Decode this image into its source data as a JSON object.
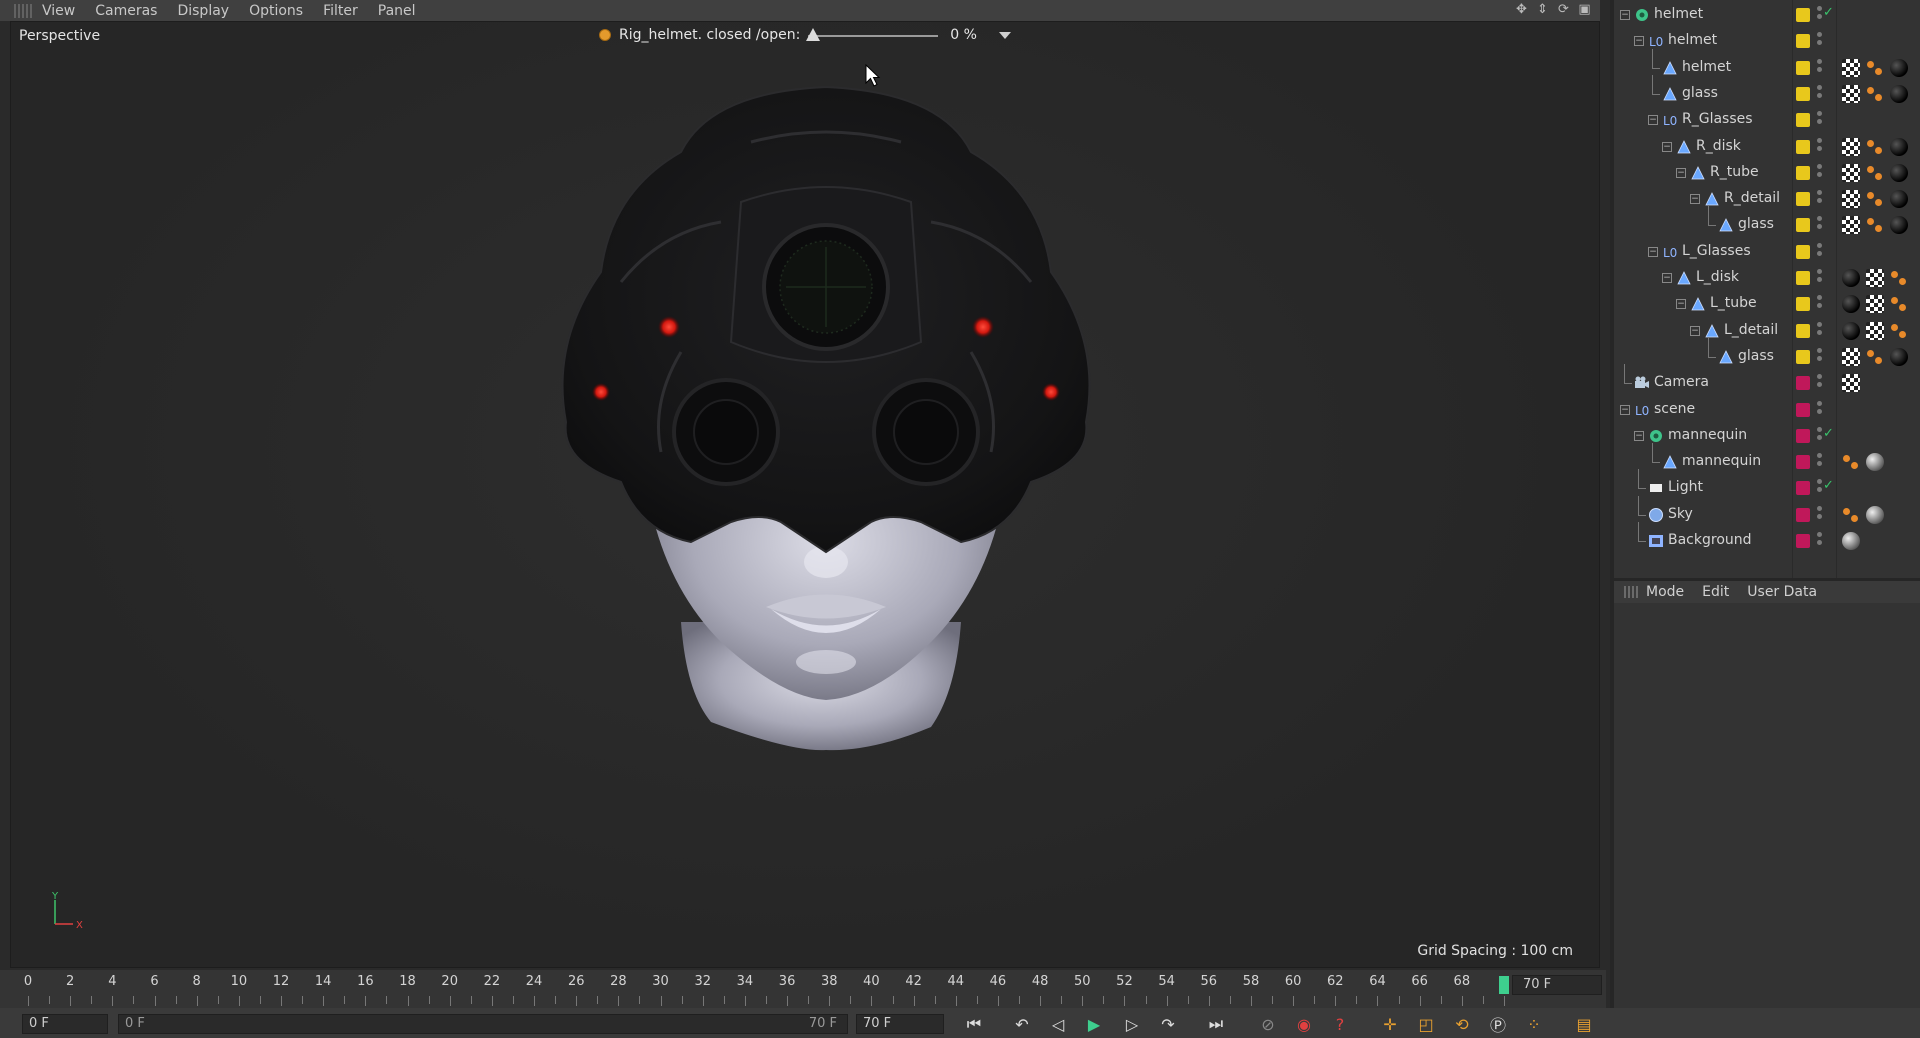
{
  "viewport_menu": {
    "items": [
      "View",
      "Cameras",
      "Display",
      "Options",
      "Filter",
      "Panel"
    ]
  },
  "viewport": {
    "label": "Perspective",
    "rig": {
      "label": "Rig_helmet. closed /open:",
      "value": "0 %",
      "fraction": 0.0
    },
    "grid_spacing": "Grid Spacing : 100 cm",
    "axis_y": "Y",
    "axis_x": "X"
  },
  "object_manager": {
    "rows": [
      {
        "name": "helmet",
        "icon": "null-green-icon",
        "color": "#e8c81c",
        "check": true
      },
      {
        "name": "helmet",
        "icon": "group-icon",
        "color": "#e8c81c"
      },
      {
        "name": "helmet",
        "icon": "polygon-icon",
        "color": "#e8c81c",
        "tags": [
          "checker",
          "rig",
          "dark"
        ]
      },
      {
        "name": "glass",
        "icon": "polygon-icon",
        "color": "#e8c81c",
        "tags": [
          "checker",
          "rig",
          "dark"
        ]
      },
      {
        "name": "R_Glasses",
        "icon": "group-icon",
        "color": "#e8c81c"
      },
      {
        "name": "R_disk",
        "icon": "polygon-icon",
        "color": "#e8c81c",
        "tags": [
          "checker",
          "rig",
          "dark"
        ]
      },
      {
        "name": "R_tube",
        "icon": "polygon-icon",
        "color": "#e8c81c",
        "tags": [
          "checker",
          "rig",
          "dark"
        ]
      },
      {
        "name": "R_detail",
        "icon": "polygon-icon",
        "color": "#e8c81c",
        "tags": [
          "checker",
          "rig",
          "dark"
        ]
      },
      {
        "name": "glass",
        "icon": "polygon-icon",
        "color": "#e8c81c",
        "tags": [
          "checker",
          "rig",
          "dark"
        ]
      },
      {
        "name": "L_Glasses",
        "icon": "group-icon",
        "color": "#e8c81c"
      },
      {
        "name": "L_disk",
        "icon": "polygon-icon",
        "color": "#e8c81c",
        "tags": [
          "dark",
          "checker",
          "rig"
        ]
      },
      {
        "name": "L_tube",
        "icon": "polygon-icon",
        "color": "#e8c81c",
        "tags": [
          "dark",
          "checker",
          "rig"
        ]
      },
      {
        "name": "L_detail",
        "icon": "polygon-icon",
        "color": "#e8c81c",
        "tags": [
          "dark",
          "checker",
          "rig"
        ]
      },
      {
        "name": "glass",
        "icon": "polygon-icon",
        "color": "#e8c81c",
        "tags": [
          "checker",
          "rig",
          "dark"
        ]
      },
      {
        "name": "Camera",
        "icon": "camera-icon",
        "color": "#c0185a",
        "tags": [
          "checker"
        ]
      },
      {
        "name": "scene",
        "icon": "group-icon",
        "color": "#c0185a"
      },
      {
        "name": "mannequin",
        "icon": "null-green-icon",
        "color": "#c0185a",
        "check": true
      },
      {
        "name": "mannequin",
        "icon": "polygon-icon",
        "color": "#c0185a",
        "tags": [
          "rig",
          "grey"
        ]
      },
      {
        "name": "Light",
        "icon": "light-icon",
        "color": "#c0185a",
        "check": true
      },
      {
        "name": "Sky",
        "icon": "sky-icon",
        "color": "#c0185a",
        "tags": [
          "rig",
          "grey"
        ]
      },
      {
        "name": "Background",
        "icon": "background-icon",
        "color": "#c0185a",
        "tags": [
          "grey"
        ]
      }
    ]
  },
  "attribute_manager": {
    "menu": [
      "Mode",
      "Edit",
      "User Data"
    ]
  },
  "timeline": {
    "ticks": [
      "0",
      "2",
      "4",
      "6",
      "8",
      "10",
      "12",
      "14",
      "16",
      "18",
      "20",
      "22",
      "24",
      "26",
      "28",
      "30",
      "32",
      "34",
      "36",
      "38",
      "40",
      "42",
      "44",
      "46",
      "48",
      "50",
      "52",
      "54",
      "56",
      "58",
      "60",
      "62",
      "64",
      "66",
      "68"
    ],
    "playhead_frame": 70,
    "max_frame": 70,
    "end_field": "70 F"
  },
  "transport": {
    "current_frame": "0 F",
    "range_start": "0 F",
    "range_end": "70 F",
    "max_field": "70 F"
  },
  "colors": {
    "accent_green": "#3ecf8e",
    "layer_yellow": "#e8c81c",
    "layer_magenta": "#c0185a"
  }
}
